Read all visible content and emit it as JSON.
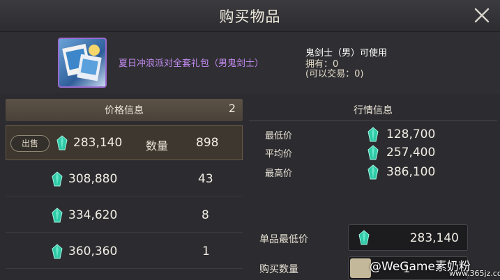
{
  "title": "购买物品",
  "item": {
    "name": "夏日冲浪派对全套礼包（男鬼剑士）",
    "usable": "鬼剑士（男）可使用",
    "owned": "拥有：0",
    "tradable": "(可以交易：0)"
  },
  "price_info": {
    "header": "价格信息",
    "count": "2",
    "sell_tag": "出售",
    "qty_label": "数量",
    "rows": [
      {
        "price": "283,140",
        "qty": "898"
      },
      {
        "price": "308,880",
        "qty": "43"
      },
      {
        "price": "334,620",
        "qty": "8"
      },
      {
        "price": "360,360",
        "qty": "1"
      }
    ]
  },
  "market": {
    "header": "行情信息",
    "rows": [
      {
        "label": "最低价",
        "value": "128,700"
      },
      {
        "label": "平均价",
        "value": "257,400"
      },
      {
        "label": "最高价",
        "value": "386,100"
      }
    ]
  },
  "purchase": {
    "min_price_label": "单品最低价",
    "min_price": "283,140",
    "qty_label": "购买数量",
    "qty": "1"
  },
  "watermark": {
    "handle": "@WeGame素奶粉",
    "site": "www.365jz.com"
  },
  "colors": {
    "accent_purple": "#c48cf2",
    "gem": "#2ec9a6"
  }
}
